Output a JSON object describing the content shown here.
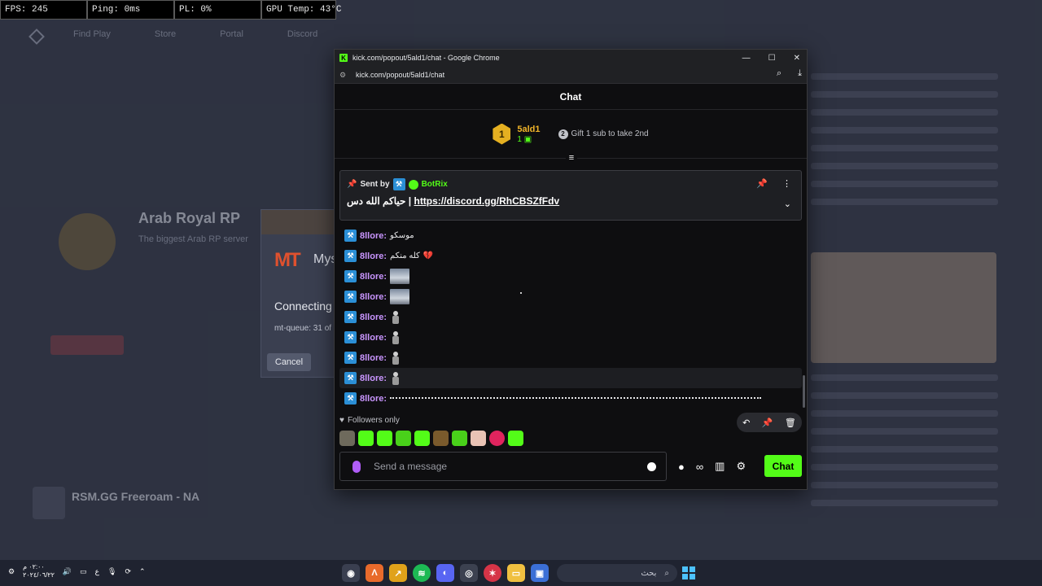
{
  "overlay": {
    "fps": "FPS: 245",
    "ping": "Ping: 0ms",
    "pl": "PL: 0%",
    "gpu": "GPU Temp: 43°C"
  },
  "background": {
    "nav": [
      "Find Play",
      "Store",
      "Portal",
      "Discord"
    ],
    "server_title": "Arab Royal RP",
    "server_sub": "The biggest Arab RP server",
    "second_server": "RSM.GG Freeroam - NA"
  },
  "launcher": {
    "logo": "MT",
    "name": "Mys",
    "connecting": "Connecting",
    "queue": "mt-queue: 31 of",
    "cancel": "Cancel"
  },
  "chrome": {
    "title": "kick.com/popout/5ald1/chat - Google Chrome",
    "url": "kick.com/popout/5ald1/chat",
    "favicon_letter": "K"
  },
  "chat": {
    "header": "Chat",
    "leader_rank": "1",
    "leader_name": "5ald1",
    "leader_count": "1",
    "gift_rank": "2",
    "gift_text": "Gift 1 sub to take 2nd",
    "pinned": {
      "sent_by": "Sent by",
      "user": "BotRix",
      "text_ar": "حياكم الله دس | ",
      "link": "https://discord.gg/RhCBSZfFdv"
    },
    "messages": [
      {
        "user": "8llore:",
        "text": "موسكو",
        "kind": "text"
      },
      {
        "user": "8llore:",
        "text": "كله منكم",
        "kind": "heart"
      },
      {
        "user": "8llore:",
        "kind": "image"
      },
      {
        "user": "8llore:",
        "kind": "image"
      },
      {
        "user": "8llore:",
        "kind": "figure"
      },
      {
        "user": "8llore:",
        "kind": "figure"
      },
      {
        "user": "8llore:",
        "kind": "figure"
      },
      {
        "user": "8llore:",
        "kind": "figure"
      },
      {
        "user": "8llore:",
        "kind": "line"
      }
    ],
    "followers_only": "Followers only",
    "placeholder": "Send a message",
    "send_label": "Chat",
    "infinity": "∞"
  },
  "taskbar": {
    "time": "٠٢:٠٠ م",
    "date": "٢٠٢٤/٠٦/٢٢",
    "lang": "ع",
    "search": "بحث"
  },
  "colors": {
    "kick_green": "#53fc18",
    "username": "#c995ff",
    "gold": "#f0b429"
  }
}
